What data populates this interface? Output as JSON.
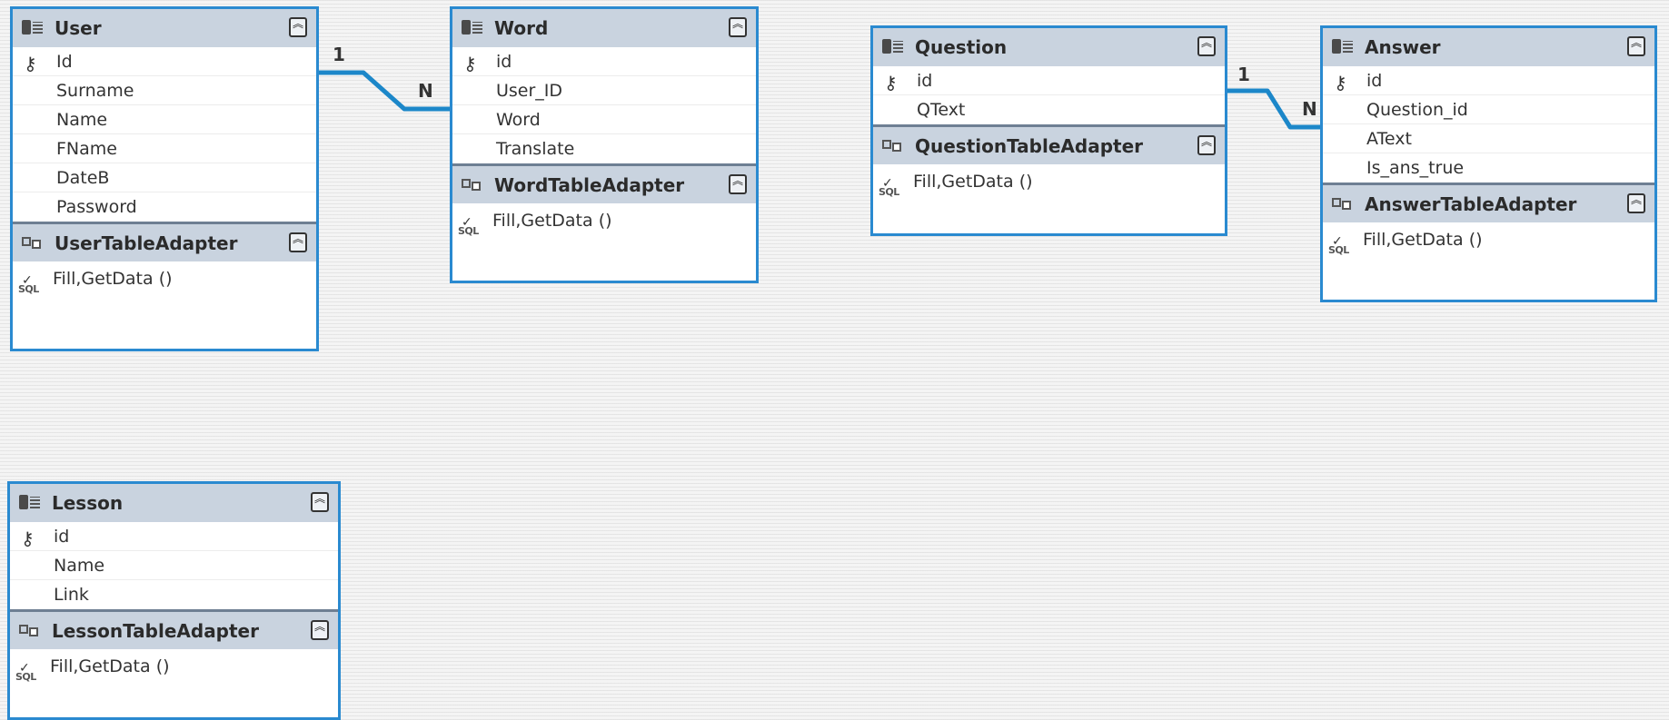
{
  "relations": [
    {
      "from": "User",
      "to": "Word",
      "from_card": "1",
      "to_card": "N"
    },
    {
      "from": "Question",
      "to": "Answer",
      "from_card": "1",
      "to_card": "N"
    }
  ],
  "tables": {
    "user": {
      "name": "User",
      "columns": [
        {
          "name": "Id",
          "key": true
        },
        {
          "name": "Surname",
          "key": false
        },
        {
          "name": "Name",
          "key": false
        },
        {
          "name": "FName",
          "key": false
        },
        {
          "name": "DateB",
          "key": false
        },
        {
          "name": "Password",
          "key": false
        }
      ],
      "adapter": "UserTableAdapter",
      "methods": "Fill,GetData ()"
    },
    "word": {
      "name": "Word",
      "columns": [
        {
          "name": "id",
          "key": true
        },
        {
          "name": "User_ID",
          "key": false
        },
        {
          "name": "Word",
          "key": false
        },
        {
          "name": "Translate",
          "key": false
        }
      ],
      "adapter": "WordTableAdapter",
      "methods": "Fill,GetData ()"
    },
    "question": {
      "name": "Question",
      "columns": [
        {
          "name": "id",
          "key": true
        },
        {
          "name": "QText",
          "key": false
        }
      ],
      "adapter": "QuestionTableAdapter",
      "methods": "Fill,GetData ()"
    },
    "answer": {
      "name": "Answer",
      "columns": [
        {
          "name": "id",
          "key": true
        },
        {
          "name": "Question_id",
          "key": false
        },
        {
          "name": "AText",
          "key": false
        },
        {
          "name": "Is_ans_true",
          "key": false
        }
      ],
      "adapter": "AnswerTableAdapter",
      "methods": "Fill,GetData ()"
    },
    "lesson": {
      "name": "Lesson",
      "columns": [
        {
          "name": "id",
          "key": true
        },
        {
          "name": "Name",
          "key": false
        },
        {
          "name": "Link",
          "key": false
        }
      ],
      "adapter": "LessonTableAdapter",
      "methods": "Fill,GetData ()"
    }
  },
  "icons": {
    "table": "datatable-icon",
    "adapter": "tableadapter-icon",
    "key": "primary-key-icon",
    "query": "sql-query-icon",
    "collapse": "collapse-chevrons-icon"
  },
  "colors": {
    "border": "#2a8ad0",
    "header": "#c9d3df",
    "relation": "#1c87c9"
  },
  "sql_label": "SQL",
  "key_glyph": "⚷",
  "collapse_glyph": "︽"
}
